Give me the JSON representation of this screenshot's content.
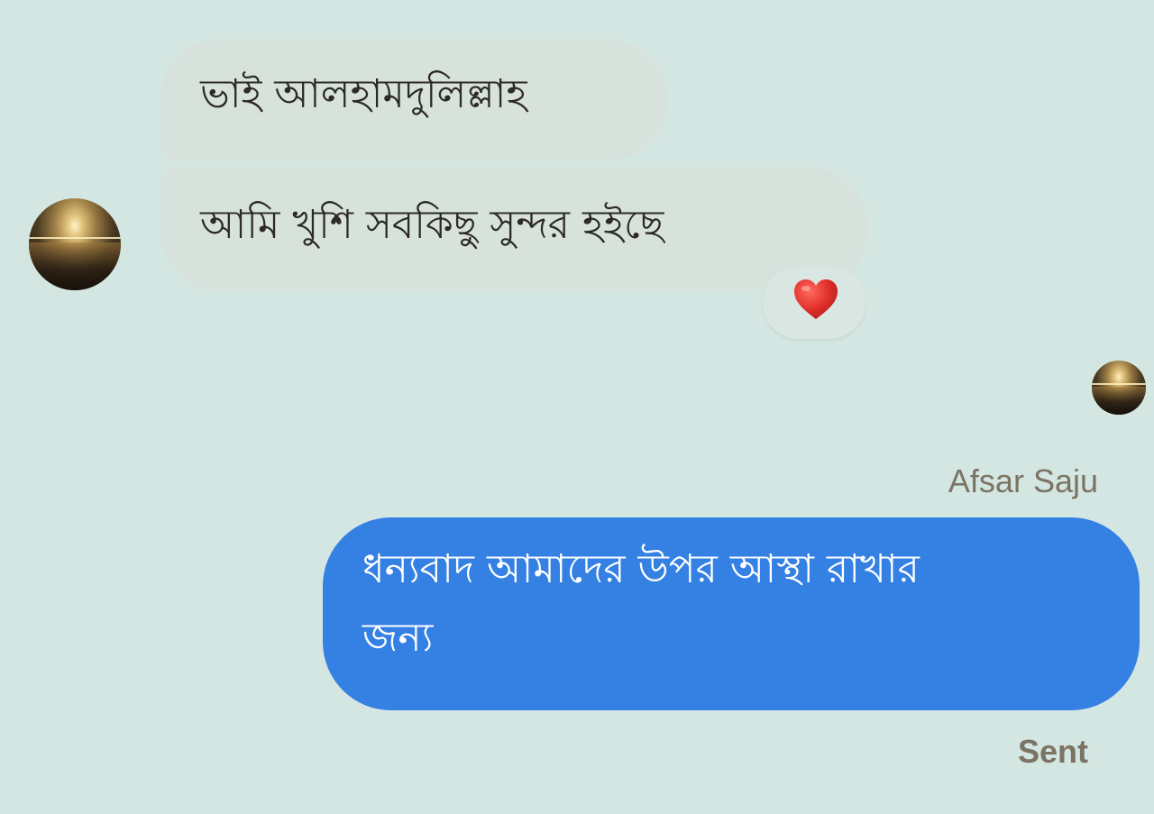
{
  "conversation": {
    "incoming": [
      {
        "text": "ভাই আলহামদুলিল্লাহ"
      },
      {
        "text": "আমি খুশি সবকিছু সুন্দর হইছে",
        "reaction": "heart-icon"
      }
    ],
    "outgoing": {
      "sender_name": "Afsar Saju",
      "lines": [
        "ধন্যবাদ আমাদের উপর আস্থা রাখার",
        "জন্য"
      ],
      "status": "Sent"
    }
  },
  "colors": {
    "background": "#d4e6e2",
    "incoming_bubble": "#d8e2dc",
    "outgoing_bubble": "#3480e3",
    "heart": "#e0302c",
    "meta_text": "#7b7464"
  }
}
